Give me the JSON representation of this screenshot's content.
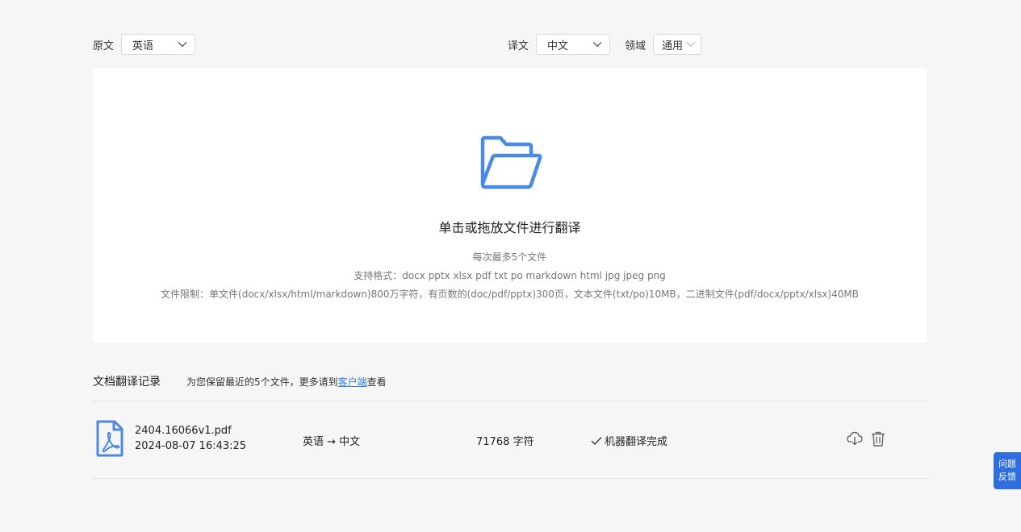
{
  "source": {
    "label": "原文",
    "value": "英语"
  },
  "target": {
    "label": "译文",
    "value": "中文"
  },
  "domain": {
    "label": "领域",
    "value": "通用"
  },
  "upload": {
    "title": "单击或拖放文件进行翻译",
    "line1": "每次最多5个文件",
    "line2": "支持格式：docx pptx xlsx pdf txt po markdown html jpg jpeg png",
    "line3": "文件限制：单文件(docx/xlsx/html/markdown)800万字符，有页数的(doc/pdf/pptx)300页，文本文件(txt/po)10MB，二进制文件(pdf/docx/pptx/xlsx)40MB"
  },
  "history": {
    "title": "文档翻译记录",
    "note_prefix": "为您保留最近的5个文件，更多请到",
    "note_link": "客户端",
    "note_suffix": "查看",
    "records": [
      {
        "file_name": "2404.16066v1.pdf",
        "time": "2024-08-07 16:43:25",
        "lang_pair": "英语 → 中文",
        "chars": "71768 字符",
        "status": "机器翻译完成"
      }
    ]
  },
  "feedback": {
    "label": "问题反馈"
  },
  "colors": {
    "accent": "#3b7fe0",
    "icon_blue": "#4a8ae6",
    "feedback_bg": "#2f6fdd"
  }
}
